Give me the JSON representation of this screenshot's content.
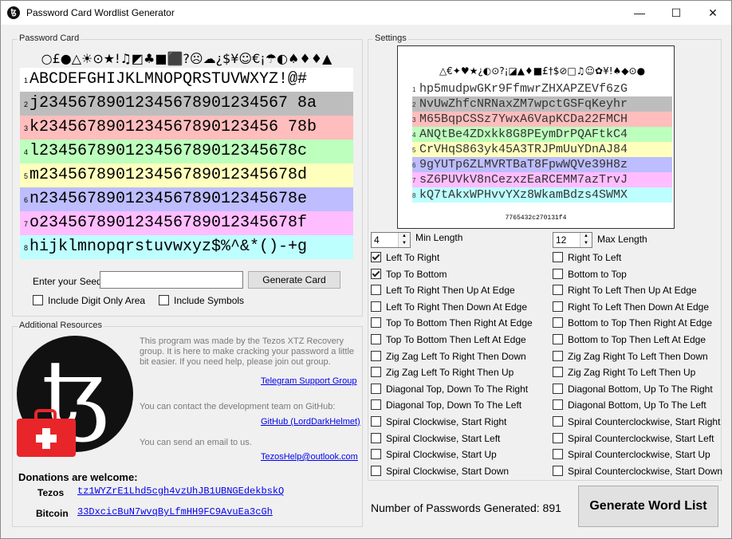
{
  "window": {
    "title": "Password Card Wordlist Generator",
    "minimize": "—",
    "maximize": "☐",
    "close": "✕"
  },
  "card_group": {
    "label": "Password Card",
    "symbol_header": "○£●△☀⊙★!♫◩♣■⬛?☹☁¿$¥☺€¡☂◐♠♦♦▲",
    "rows": [
      {
        "num": "1",
        "text": "ABCDEFGHIJKLMNOPQRSTUVWXYZ!@#",
        "color": "#ffffff"
      },
      {
        "num": "2",
        "text": "j23456789012345678901234567 8a",
        "color": "#bdbdbd"
      },
      {
        "num": "3",
        "text": "k2345678901234567890123456 78b",
        "color": "#ffbdbd"
      },
      {
        "num": "4",
        "text": "l234567890123456789012345678c",
        "color": "#bdffbd"
      },
      {
        "num": "5",
        "text": "m234567890123456789012345678d",
        "color": "#ffffbd"
      },
      {
        "num": "6",
        "text": "n234567890123456789012345678e",
        "color": "#bdbdff"
      },
      {
        "num": "7",
        "text": "o234567890123456789012345678f",
        "color": "#ffbdff"
      },
      {
        "num": "8",
        "text": "hijklmnopqrstuvwxyz$%^&*()-+g",
        "color": "#bdffff"
      }
    ],
    "seed_label": "Enter your Seed",
    "seed_value": "",
    "generate_card": "Generate Card",
    "include_digit_only": "Include Digit Only Area",
    "include_symbols": "Include Symbols"
  },
  "resources": {
    "label": "Additional Resources",
    "intro": "This program was made by the Tezos XTZ Recovery group. It is here to make cracking your password a little bit easier. If you need help, please join out group.",
    "telegram": "Telegram Support Group",
    "contact": "You can contact the development team on  GitHub:",
    "github": "GitHub (LordDarkHelmet)",
    "email_text": "You can send an email to us.",
    "email": "TezosHelp@outlook.com",
    "donations": "Donations are welcome:",
    "tezos_label": "Tezos",
    "tezos_addr": "tz1WYZrE1Lhd5cgh4vzUhJB1UBNGEdekbskQ",
    "bitcoin_label": "Bitcoin",
    "bitcoin_addr": "33DxcicBuN7wvqByLfmHH9FC9AvuEa3cGh",
    "logo_letter": "ꜩ"
  },
  "settings": {
    "label": "Settings",
    "preview_symbols": "△€✦♥★¿◐⊙?¡◪▲♦■£†$⊘□♫☺✿¥!♠◆⊙●",
    "preview_rows": [
      {
        "num": "1",
        "text": "hp5mudpwGKr9FfmwrZHXAPZEVf6zG",
        "color": "#ffffff"
      },
      {
        "num": "2",
        "text": "NvUwZhfcNRNaxZM7wpctGSFqKeyhr",
        "color": "#bdbdbd"
      },
      {
        "num": "3",
        "text": "M65BqpCSSz7YwxA6VapKCDa22FMCH",
        "color": "#ffbdbd"
      },
      {
        "num": "4",
        "text": "ANQtBe4ZDxkk8G8PEymDrPQAFtkC4",
        "color": "#bdffbd"
      },
      {
        "num": "5",
        "text": "CrVHqS863yk45A3TRJPmUuYDnAJ84",
        "color": "#ffffbd"
      },
      {
        "num": "6",
        "text": "9gYUTp6ZLMVRTBaT8FpwWQVe39H8z",
        "color": "#bdbdff"
      },
      {
        "num": "7",
        "text": "sZ6PUVkV8nCezxzEaRCEMM7azTrvJ",
        "color": "#ffbdff"
      },
      {
        "num": "8",
        "text": "kQ7tAkxWPHvvYXz8WkamBdzs4SWMX",
        "color": "#bdffff"
      }
    ],
    "preview_seed": "7765432c270131f4",
    "min_length_label": "Min Length",
    "min_length": "4",
    "max_length_label": "Max Length",
    "max_length": "12",
    "options_left": [
      {
        "label": "Left To Right",
        "checked": true
      },
      {
        "label": "Top To Bottom",
        "checked": true
      },
      {
        "label": "Left To Right Then Up At Edge",
        "checked": false
      },
      {
        "label": "Left To Right Then Down At Edge",
        "checked": false
      },
      {
        "label": "Top To Bottom Then Right At Edge",
        "checked": false
      },
      {
        "label": "Top To Bottom Then Left At Edge",
        "checked": false
      },
      {
        "label": "Zig Zag Left To Right Then Down",
        "checked": false
      },
      {
        "label": "Zig Zag Left To Right Then Up",
        "checked": false
      },
      {
        "label": "Diagonal Top, Down To The Right",
        "checked": false
      },
      {
        "label": "Diagonal Top, Down To The Left",
        "checked": false
      },
      {
        "label": "Spiral Clockwise, Start Right",
        "checked": false
      },
      {
        "label": "Spiral Clockwise, Start Left",
        "checked": false
      },
      {
        "label": "Spiral Clockwise, Start Up",
        "checked": false
      },
      {
        "label": "Spiral Clockwise, Start Down",
        "checked": false
      }
    ],
    "options_right": [
      {
        "label": "Right To Left",
        "checked": false
      },
      {
        "label": "Bottom to Top",
        "checked": false
      },
      {
        "label": "Right To Left Then Up At Edge",
        "checked": false
      },
      {
        "label": "Right To Left Then Down At Edge",
        "checked": false
      },
      {
        "label": "Bottom to Top Then Right At Edge",
        "checked": false
      },
      {
        "label": "Bottom to Top Then Left At Edge",
        "checked": false
      },
      {
        "label": "Zig Zag Right To Left Then Down",
        "checked": false
      },
      {
        "label": "Zig Zag Right To Left Then Up",
        "checked": false
      },
      {
        "label": "Diagonal Bottom, Up To The Right",
        "checked": false
      },
      {
        "label": "Diagonal Bottom, Up To The Left",
        "checked": false
      },
      {
        "label": "Spiral Counterclockwise, Start Right",
        "checked": false
      },
      {
        "label": "Spiral Counterclockwise, Start Left",
        "checked": false
      },
      {
        "label": "Spiral Counterclockwise, Start Up",
        "checked": false
      },
      {
        "label": "Spiral Counterclockwise, Start Down",
        "checked": false
      }
    ]
  },
  "footer": {
    "count_label": "Number of Passwords Generated:",
    "count": "891",
    "generate_button": "Generate Word List"
  }
}
